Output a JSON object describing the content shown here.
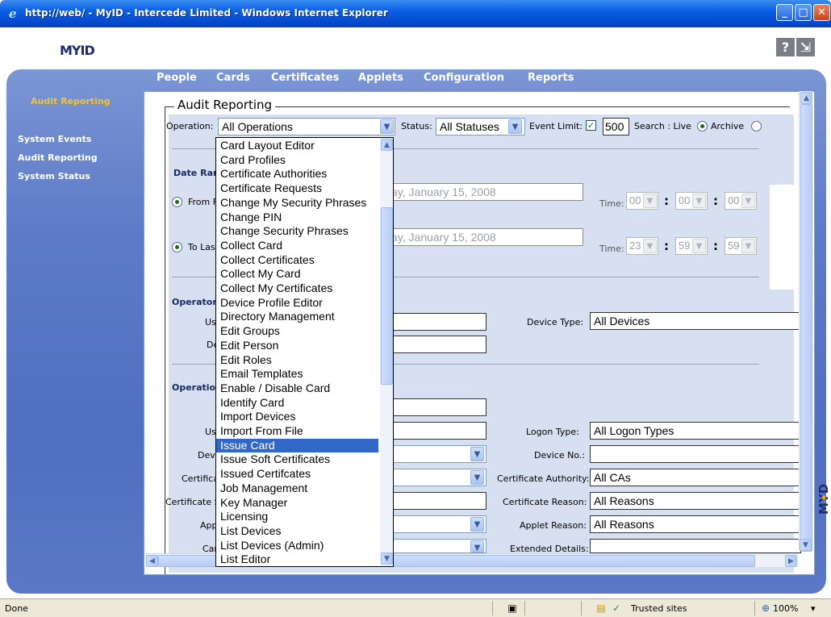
{
  "window": {
    "title": "http://web/ - MyID - Intercede Limited - Windows Internet Explorer"
  },
  "header": {
    "logo": "MYID",
    "help_label": "?",
    "exit_label": "⇲"
  },
  "menu": [
    "People",
    "Cards",
    "Certificates",
    "Applets",
    "Configuration",
    "Reports"
  ],
  "sidebar": {
    "title": "Audit Reporting",
    "items": [
      "System Events",
      "Audit Reporting",
      "System Status"
    ]
  },
  "form": {
    "legend": "Audit Reporting",
    "operation_label": "Operation:",
    "operation_value": "All Operations",
    "status_label": "Status:",
    "status_value": "All Statuses",
    "event_limit_label": "Event Limit:",
    "event_limit_checked": true,
    "event_limit_value": "500",
    "search_label": "Search : Live",
    "archive_label": "Archive",
    "date_range_label": "Date Ran",
    "from_label": "From F",
    "from_date": "ay, January 15, 2008",
    "to_label": "To Last",
    "to_date": "ay, January 15, 2008",
    "time_label": "Time:",
    "from_time": [
      "00",
      "00",
      "00"
    ],
    "to_time": [
      "23",
      "59",
      "59"
    ],
    "operator_section": "Operator",
    "operator_user_label": "Us",
    "operator_device_label": "De",
    "device_type_label": "Device Type:",
    "device_type_value": "All Devices",
    "operation_section": "Operatio",
    "op_user_label": "Us",
    "logon_type_label": "Logon Type:",
    "logon_type_value": "All Logon Types",
    "dev_label": "Dev",
    "device_no_label": "Device No.:",
    "certifica_label": "Certifica",
    "cert_authority_label": "Certificate Authority:",
    "cert_authority_value": "All CAs",
    "certificate_s_label": "Certificate S",
    "cert_reason_label": "Certificate Reason:",
    "cert_reason_value": "All Reasons",
    "appl_label": "Appl",
    "applet_reason_label": "Applet Reason:",
    "applet_reason_value": "All Reasons",
    "car_label": "Car",
    "extended_details_label": "Extended Details:"
  },
  "operation_dropdown": {
    "items": [
      "Card Layout Editor",
      "Card Profiles",
      "Certificate Authorities",
      "Certificate Requests",
      "Change My Security Phrases",
      "Change PIN",
      "Change Security Phrases",
      "Collect Card",
      "Collect Certificates",
      "Collect My Card",
      "Collect My Certificates",
      "Device Profile Editor",
      "Directory Management",
      "Edit Groups",
      "Edit Person",
      "Edit Roles",
      "Email Templates",
      "Enable / Disable Card",
      "Identify Card",
      "Import Devices",
      "Import From File",
      "Issue Card",
      "Issue Soft Certificates",
      "Issued Certifcates",
      "Job Management",
      "Key Manager",
      "Licensing",
      "List Devices",
      "List Devices (Admin)",
      "List Editor"
    ],
    "selected": "Issue Card"
  },
  "statusbar": {
    "status": "Done",
    "zone": "Trusted sites",
    "zoom": "100%"
  },
  "colors": {
    "title_bar": "#0a5fe4",
    "chrome_blue": "#5d7bc8",
    "form_bg": "#d7e0f0",
    "selection": "#3168c8",
    "sidebar_title": "#f0c430"
  }
}
